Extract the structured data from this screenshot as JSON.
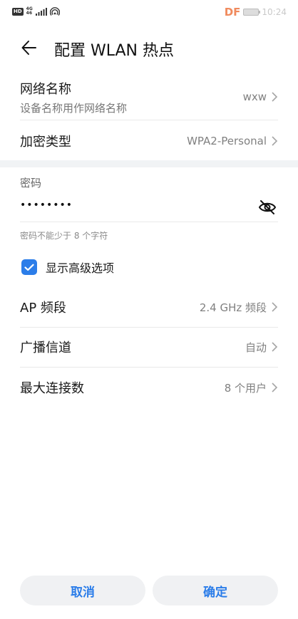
{
  "status_bar": {
    "hd_label": "HD",
    "net_label_top": "4G",
    "net_label_bottom": "46",
    "watermark": "DF",
    "time": "10:24"
  },
  "header": {
    "title": "配置 WLAN 热点"
  },
  "network_name": {
    "title": "网络名称",
    "subtitle": "设备名称用作网络名称",
    "value": "wxw"
  },
  "encryption": {
    "title": "加密类型",
    "value": "WPA2-Personal"
  },
  "password": {
    "label": "密码",
    "masked_value": "••••••••",
    "hint": "密码不能少于 8 个字符"
  },
  "advanced": {
    "label": "显示高级选项",
    "checked": true
  },
  "ap_band": {
    "title": "AP 频段",
    "value": "2.4 GHz 频段"
  },
  "channel": {
    "title": "广播信道",
    "value": "自动"
  },
  "max_connections": {
    "title": "最大连接数",
    "value": "8 个用户"
  },
  "buttons": {
    "cancel": "取消",
    "ok": "确定"
  },
  "colors": {
    "accent": "#2b7de9",
    "button_bg": "#f0f1f3",
    "section_gap": "#f1f3f5"
  }
}
